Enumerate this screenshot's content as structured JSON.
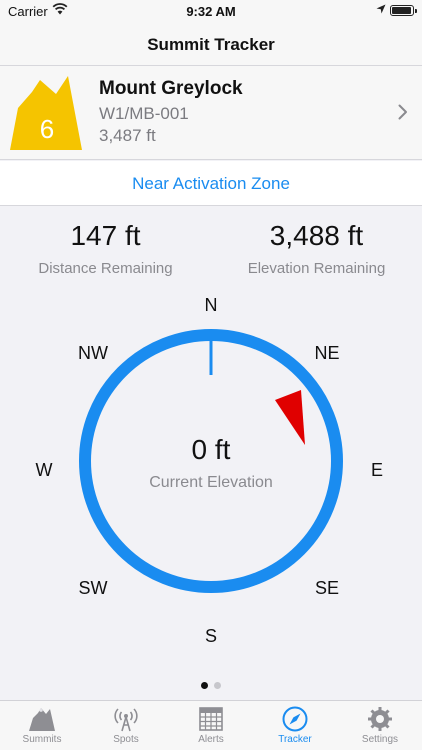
{
  "status_bar": {
    "carrier": "Carrier",
    "time": "9:32 AM"
  },
  "nav": {
    "title": "Summit Tracker"
  },
  "summit": {
    "points_badge": "6",
    "name": "Mount Greylock",
    "code": "W1/MB-001",
    "elevation": "3,487 ft",
    "badge_color": "#f5c400"
  },
  "zone": {
    "status": "Near Activation Zone"
  },
  "stats": {
    "distance_value": "147 ft",
    "distance_label": "Distance Remaining",
    "elevation_value": "3,488 ft",
    "elevation_label": "Elevation Remaining"
  },
  "compass": {
    "directions": {
      "n": "N",
      "ne": "NE",
      "e": "E",
      "se": "SE",
      "s": "S",
      "sw": "SW",
      "w": "W",
      "nw": "NW"
    },
    "current_elevation_value": "0 ft",
    "current_elevation_label": "Current Elevation",
    "ring_color": "#1a8cf0",
    "pointer_color": "#e00000"
  },
  "pager": {
    "pages": 2,
    "active_page": 1
  },
  "tabs": [
    {
      "label": "Summits",
      "icon": "mountain-icon"
    },
    {
      "label": "Spots",
      "icon": "radio-tower-icon"
    },
    {
      "label": "Alerts",
      "icon": "calendar-icon"
    },
    {
      "label": "Tracker",
      "icon": "compass-icon",
      "active": true
    },
    {
      "label": "Settings",
      "icon": "gear-icon"
    }
  ]
}
